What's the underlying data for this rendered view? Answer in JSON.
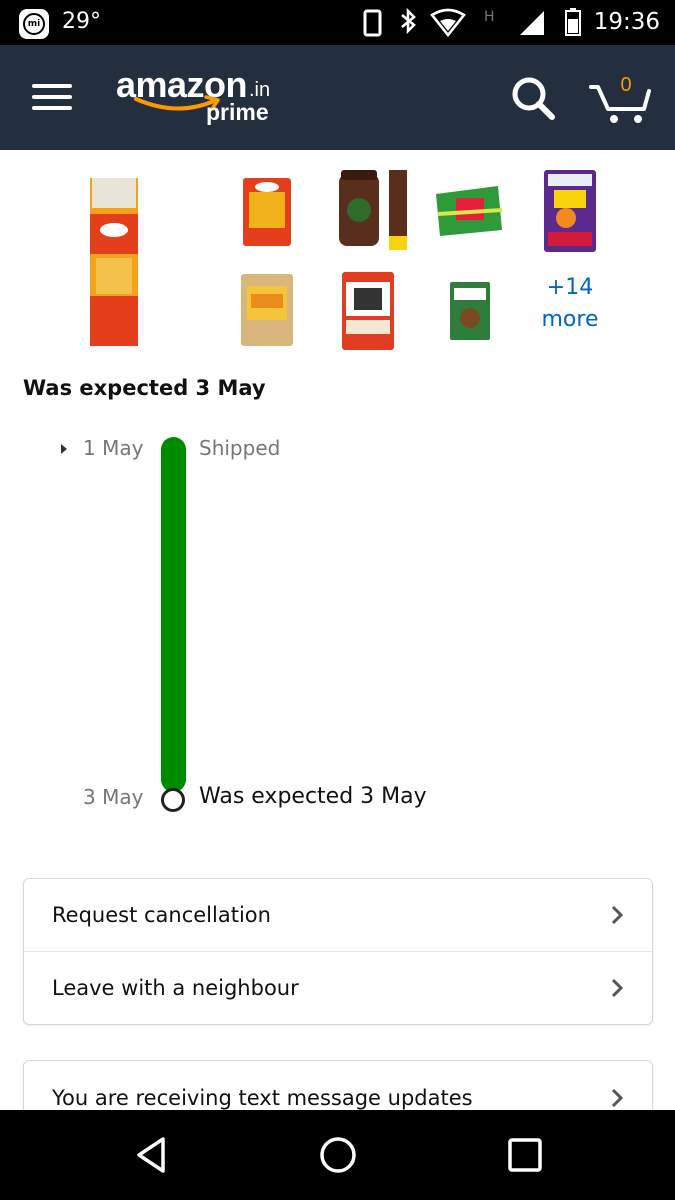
{
  "status_bar": {
    "temperature": "29°",
    "time": "19:36",
    "network_type": "H"
  },
  "header": {
    "logo_main": "amazon",
    "logo_tld": ".in",
    "logo_sub": "prime",
    "cart_count": "0"
  },
  "products": {
    "more_count": "+14",
    "more_label": "more"
  },
  "section_title": "Was expected 3 May",
  "timeline": {
    "start_date": "1 May",
    "start_status": "Shipped",
    "end_date": "3 May",
    "end_status": "Was expected 3 May",
    "bar_color": "#008a00"
  },
  "actions": [
    {
      "label": "Request cancellation"
    },
    {
      "label": "Leave with a neighbour"
    }
  ],
  "notifications": {
    "label": "You are receiving text message updates"
  },
  "colors": {
    "header_bg": "#232f3e",
    "accent": "#f90",
    "link": "#0066c0"
  }
}
